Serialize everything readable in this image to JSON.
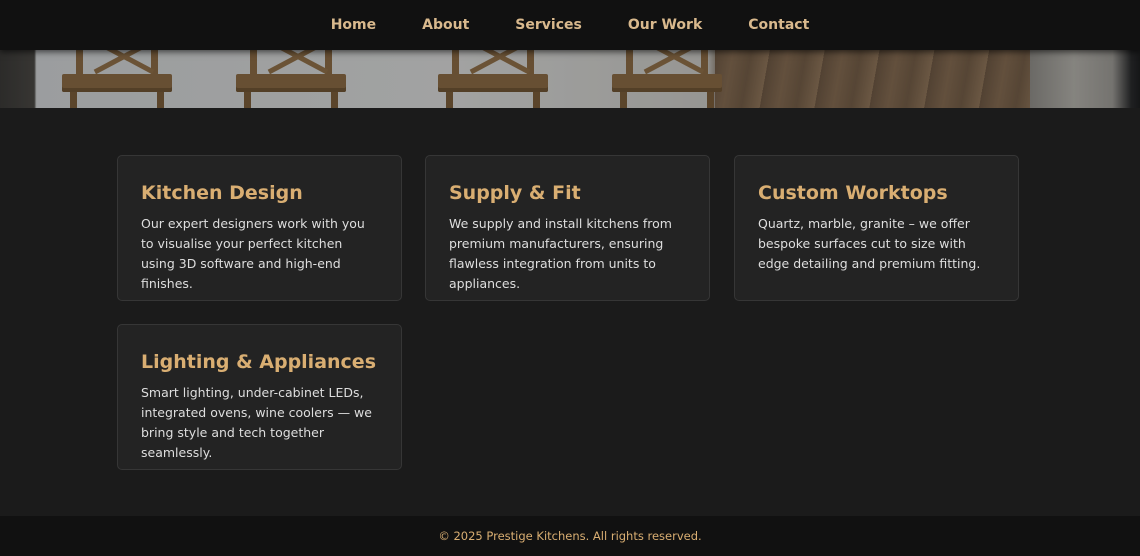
{
  "nav": {
    "items": [
      {
        "label": "Home"
      },
      {
        "label": "About"
      },
      {
        "label": "Services"
      },
      {
        "label": "Our Work"
      },
      {
        "label": "Contact"
      }
    ]
  },
  "services": [
    {
      "title": "Kitchen Design",
      "description": "Our expert designers work with you to visualise your perfect kitchen using 3D software and high-end finishes."
    },
    {
      "title": "Supply & Fit",
      "description": "We supply and install kitchens from premium manufacturers, ensuring flawless integration from units to appliances."
    },
    {
      "title": "Custom Worktops",
      "description": "Quartz, marble, granite – we offer bespoke surfaces cut to size with edge detailing and premium fitting."
    },
    {
      "title": "Lighting & Appliances",
      "description": "Smart lighting, under-cabinet LEDs, integrated ovens, wine coolers — we bring style and tech together seamlessly."
    }
  ],
  "footer": {
    "text": "© 2025 Prestige Kitchens. All rights reserved."
  },
  "colors": {
    "accent": "#d9ae72",
    "background": "#1b1b1b",
    "card": "#232323",
    "nav": "#111111"
  }
}
